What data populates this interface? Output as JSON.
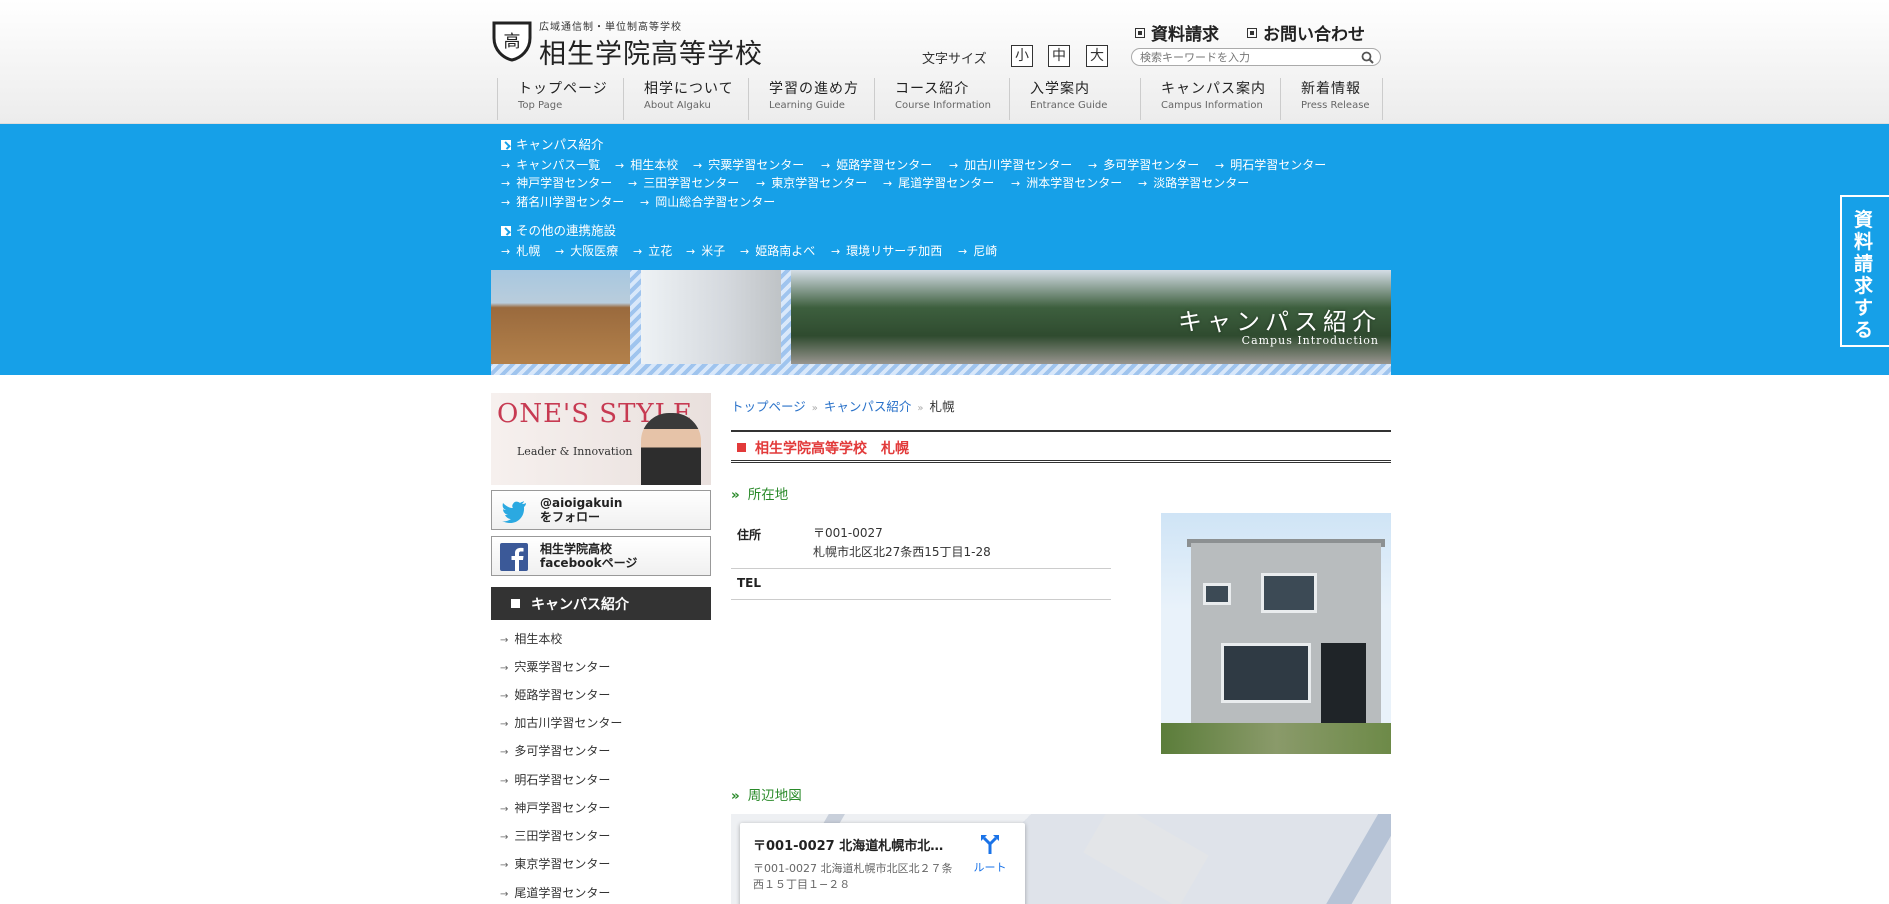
{
  "header": {
    "logo_sub": "広域通信制・単位制高等学校",
    "logo_name": "相生学院高等学校",
    "logo_mark": "高",
    "toplinks": [
      "資料請求",
      "お問い合わせ"
    ],
    "font_size_label": "文字サイズ",
    "font_sizes": [
      "小",
      "中",
      "大"
    ],
    "search_placeholder": "検索キーワードを入力"
  },
  "gnav": [
    {
      "ja": "トップページ",
      "en": "Top Page"
    },
    {
      "ja": "相学について",
      "en": "About AIgaku"
    },
    {
      "ja": "学習の進め方",
      "en": "Learning Guide"
    },
    {
      "ja": "コース紹介",
      "en": "Course Information"
    },
    {
      "ja": "入学案内",
      "en": "Entrance Guide"
    },
    {
      "ja": "キャンパス案内",
      "en": "Campus Information"
    },
    {
      "ja": "新着情報",
      "en": "Press Release"
    }
  ],
  "subnav": {
    "campus_heading": "キャンパス紹介",
    "campus_links": [
      "キャンパス一覧",
      "相生本校",
      "宍粟学習センター",
      "姫路学習センター",
      "加古川学習センター",
      "多可学習センター",
      "明石学習センター",
      "神戸学習センター",
      "三田学習センター",
      "東京学習センター",
      "尾道学習センター",
      "洲本学習センター",
      "淡路学習センター",
      "猪名川学習センター",
      "岡山総合学習センター"
    ],
    "partner_heading": "その他の連携施設",
    "partner_links": [
      "札幌",
      "大阪医療",
      "立花",
      "米子",
      "姫路南よべ",
      "環境リサーチ加西",
      "尼崎"
    ]
  },
  "hero": {
    "title": "キャンパス紹介",
    "subtitle": "Campus Introduction"
  },
  "side_tab": "資料請求する",
  "sidebar": {
    "banner_title": "ONE'S STYLE",
    "banner_caption": "Leader & Innovation",
    "twitter": {
      "line1": "@aioigakuin",
      "line2": "をフォロー"
    },
    "facebook": {
      "line1": "相生学院高校",
      "line2": "facebookページ"
    },
    "heading": "キャンパス紹介",
    "items": [
      "相生本校",
      "宍粟学習センター",
      "姫路学習センター",
      "加古川学習センター",
      "多可学習センター",
      "明石学習センター",
      "神戸学習センター",
      "三田学習センター",
      "東京学習センター",
      "尾道学習センター"
    ]
  },
  "breadcrumb": {
    "items": [
      "トップページ",
      "キャンパス紹介"
    ],
    "current": "札幌"
  },
  "page_title": "相生学院高等学校　札幌",
  "location": {
    "heading": "所在地",
    "address_label": "住所",
    "postal": "〒001-0027",
    "address": "札幌市北区北27条西15丁目1-28",
    "tel_label": "TEL",
    "tel": ""
  },
  "map": {
    "heading": "周辺地図",
    "card_title": "〒001-0027 北海道札幌市北区...",
    "card_address": "〒001-0027 北海道札幌市北区北２７条西１５丁目１−２８",
    "route_label": "ルート"
  },
  "colors": {
    "band_blue": "#16a0e8",
    "title_red": "#e23a3a",
    "heading_green": "#2a8a2a",
    "link_blue": "#2a72c9"
  }
}
